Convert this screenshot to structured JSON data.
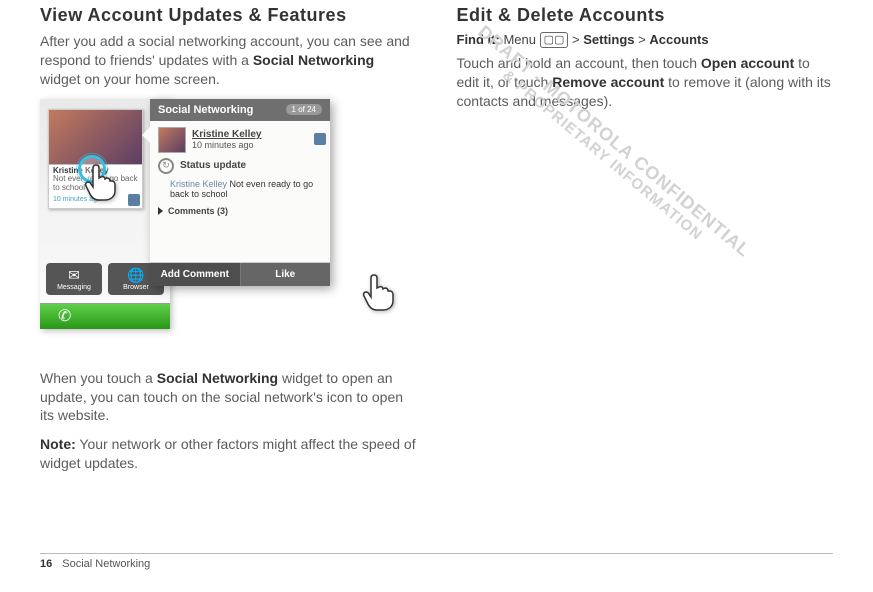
{
  "left": {
    "heading": "View Account Updates & Features",
    "intro_a": "After you add a social networking account, you can see and respond to friends' updates with a ",
    "intro_b_bold": "Social Networking",
    "intro_c": " widget on your home screen.",
    "tap_text_a": "When you touch a ",
    "tap_text_bold": "Social Networking",
    "tap_text_b": " widget to open an update, you can touch on the social network's icon to open its website.",
    "note_label": "Note:",
    "note_text": " Your network or other factors might affect the speed of widget updates."
  },
  "widget": {
    "card_name": "Kristine Kelley",
    "card_status": "Not even ready go back to school",
    "card_time": "10 minutes ago",
    "dock_msg": "Messaging",
    "dock_browser": "Browser",
    "popup_title": "Social Networking",
    "popup_count": "1 of 24",
    "pop_name": "Kristine Kelley",
    "pop_time": "10 minutes ago",
    "stat_label": "Status update",
    "post_name": "Kristine Kelley",
    "post_body": "Not even ready to go back to school",
    "comments": "Comments (3)",
    "btn_add": "Add Comment",
    "btn_like": "Like"
  },
  "right": {
    "heading": "Edit & Delete Accounts",
    "find_label": "Find it:",
    "find_menu": "Menu",
    "find_sep": ">",
    "find_settings": "Settings",
    "find_accounts": "Accounts",
    "body_a": "Touch and hold an account, then touch ",
    "body_bold1": "Open account",
    "body_b": " to edit it, or touch ",
    "body_bold2": "Remove account",
    "body_c": " to remove it (along with its contacts and messages)."
  },
  "footer": {
    "page": "16",
    "title": "Social Networking"
  },
  "watermark": {
    "line1": "DRAFT - MOTOROLA CONFIDENTIAL",
    "line2": "& PROPRIETARY INFORMATION"
  }
}
